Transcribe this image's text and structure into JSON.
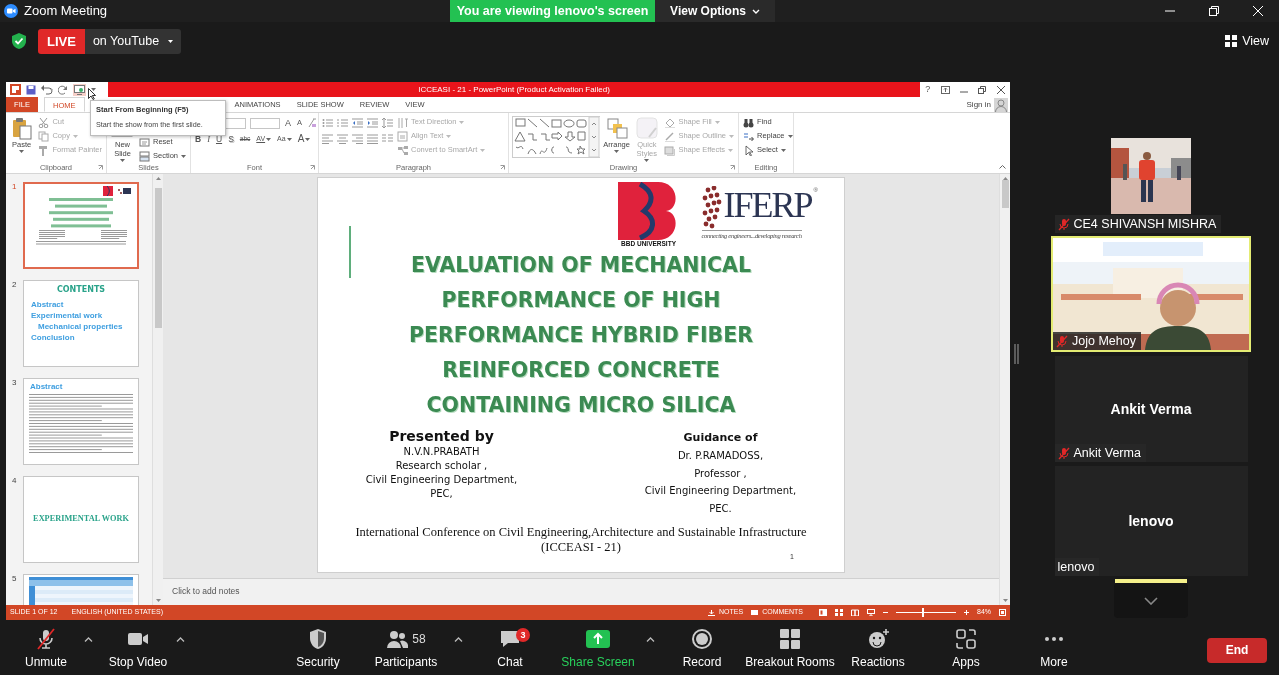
{
  "window": {
    "title": "Zoom Meeting"
  },
  "share_banner": {
    "text": "You are viewing lenovo's screen",
    "options": "View Options"
  },
  "live": {
    "badge": "LIVE",
    "destination": "on YouTube"
  },
  "view_button": "View",
  "powerpoint": {
    "title": "ICCEASI - 21 -  PowerPoint (Product Activation Failed)",
    "help": "?",
    "tabs": [
      {
        "label": "FILE",
        "kind": "file",
        "selected": false
      },
      {
        "label": "HOME",
        "kind": "tab",
        "selected": true
      },
      {
        "label": "ANIMATIONS",
        "kind": "tab",
        "selected": false
      },
      {
        "label": "SLIDE SHOW",
        "kind": "tab",
        "selected": false
      },
      {
        "label": "REVIEW",
        "kind": "tab",
        "selected": false
      },
      {
        "label": "VIEW",
        "kind": "tab",
        "selected": false
      }
    ],
    "sign_in": "Sign in",
    "tooltip": {
      "title": "Start From Beginning (F5)",
      "text": "Start the show from the first slide."
    },
    "ribbon": [
      {
        "label": "Clipboard",
        "items": [
          {
            "kind": "large",
            "label": "Paste",
            "dropdown": true,
            "disabled": false
          },
          {
            "kind": "small",
            "label": "Cut",
            "dropdown": false,
            "disabled": true
          },
          {
            "kind": "small",
            "label": "Copy",
            "dropdown": true,
            "disabled": true
          },
          {
            "kind": "small",
            "label": "Format Painter",
            "dropdown": false,
            "disabled": true
          }
        ]
      },
      {
        "label": "Slides",
        "items": [
          {
            "kind": "large",
            "label": "New Slide",
            "dropdown": true,
            "disabled": false
          },
          {
            "kind": "small",
            "label": "Reset",
            "dropdown": false,
            "disabled": false
          },
          {
            "kind": "small",
            "label": "Section",
            "dropdown": true,
            "disabled": false
          }
        ]
      },
      {
        "label": "Font",
        "buttons_top": [
          "A",
          "A"
        ],
        "buttons": [
          "B",
          "I",
          "U",
          "S",
          "abc",
          "AV",
          "Aa",
          "A"
        ]
      },
      {
        "label": "Paragraph",
        "items": [
          {
            "kind": "small",
            "label": "Text Direction",
            "dropdown": true,
            "disabled": true
          },
          {
            "kind": "small",
            "label": "Align Text",
            "dropdown": true,
            "disabled": true
          },
          {
            "kind": "small",
            "label": "Convert to SmartArt",
            "dropdown": true,
            "disabled": true
          }
        ]
      },
      {
        "label": "Drawing",
        "items": [
          {
            "kind": "large",
            "label": "Arrange",
            "dropdown": true,
            "disabled": false
          },
          {
            "kind": "large",
            "label": "Quick Styles",
            "dropdown": true,
            "disabled": true
          },
          {
            "kind": "small",
            "label": "Shape Fill",
            "dropdown": true,
            "disabled": true
          },
          {
            "kind": "small",
            "label": "Shape Outline",
            "dropdown": true,
            "disabled": true
          },
          {
            "kind": "small",
            "label": "Shape Effects",
            "dropdown": true,
            "disabled": true
          }
        ]
      },
      {
        "label": "Editing",
        "items": [
          {
            "kind": "small",
            "label": "Find",
            "dropdown": false,
            "disabled": false
          },
          {
            "kind": "small",
            "label": "Replace",
            "dropdown": true,
            "disabled": false
          },
          {
            "kind": "small",
            "label": "Select",
            "dropdown": true,
            "disabled": false
          }
        ]
      }
    ],
    "slides": [
      {
        "number": "1",
        "selected": true,
        "kind": "title"
      },
      {
        "number": "2",
        "selected": false,
        "kind": "contents",
        "heading": "CONTENTS",
        "items": [
          {
            "text": "Abstract"
          },
          {
            "text": "Experimental work",
            "children": [
              {
                "text": "Mechanical properties"
              }
            ]
          },
          {
            "text": "Conclusion"
          }
        ]
      },
      {
        "number": "3",
        "selected": false,
        "kind": "text",
        "heading": "Abstract"
      },
      {
        "number": "4",
        "selected": false,
        "kind": "section",
        "heading": "EXPERIMENTAL WORK"
      },
      {
        "number": "5",
        "selected": false,
        "kind": "table"
      }
    ],
    "slide": {
      "logo_caption": "BBD UNIVERSITY",
      "logo_name": "IFERP",
      "logo_mark": "®",
      "logo_tagline": "connecting engineers...developing research",
      "title_lines": [
        "EVALUATION OF MECHANICAL",
        "PERFORMANCE OF HIGH",
        "PERFORMANCE HYBRID FIBER",
        "REINFORCED CONCRETE",
        "CONTAINING MICRO SILICA"
      ],
      "presenter": {
        "heading": "Presented by",
        "lines": [
          "N.V.N.PRABATH",
          "Research scholar ,",
          "Civil Engineering Department,",
          "PEC,"
        ]
      },
      "guide": {
        "heading": "Guidance of",
        "lines": [
          "Dr. P.RAMADOSS,",
          "Professor ,",
          "Civil Engineering Department,",
          "PEC."
        ]
      },
      "footer_lines": [
        "International Conference on Civil Engineering,Architecture and Sustainable Infrastructure",
        "(ICCEASI - 21)"
      ],
      "page_number": "1"
    },
    "notes_placeholder": "Click to add notes",
    "status_bar": {
      "slide": "SLIDE 1 OF 12",
      "language": "ENGLISH (UNITED STATES)",
      "notes": "NOTES",
      "comments": "COMMENTS",
      "zoom": "84%",
      "zoom_slider": {
        "level": 0.45
      }
    }
  },
  "participants": [
    {
      "name": "CE4 SHIVANSH MISHRA",
      "kind": "video",
      "muted": true,
      "speaking": false
    },
    {
      "name": "Jojo Mehoy",
      "kind": "video",
      "muted": true,
      "speaking": true
    },
    {
      "name": "Ankit Verma",
      "kind": "name",
      "tile_name": "Ankit Verma",
      "muted": true,
      "speaking": false
    },
    {
      "name": "lenovo",
      "kind": "name",
      "tile_name": "lenovo",
      "muted": false,
      "speaking": false
    }
  ],
  "toolbar": [
    {
      "label": "Unmute",
      "kind": "mic",
      "menu": true
    },
    {
      "label": "Stop Video",
      "kind": "video",
      "menu": true
    },
    {
      "label": "Security",
      "kind": "security",
      "menu": false
    },
    {
      "label": "Participants",
      "kind": "participants",
      "count": "58",
      "menu": true
    },
    {
      "label": "Chat",
      "kind": "chat",
      "badge": "3",
      "menu": false
    },
    {
      "label": "Share Screen",
      "kind": "share",
      "menu": true
    },
    {
      "label": "Record",
      "kind": "record",
      "menu": false
    },
    {
      "label": "Breakout Rooms",
      "kind": "breakout",
      "menu": false
    },
    {
      "label": "Reactions",
      "kind": "reactions",
      "menu": false
    },
    {
      "label": "Apps",
      "kind": "apps",
      "menu": false
    },
    {
      "label": "More",
      "kind": "more",
      "menu": false
    }
  ],
  "end_button": "End"
}
